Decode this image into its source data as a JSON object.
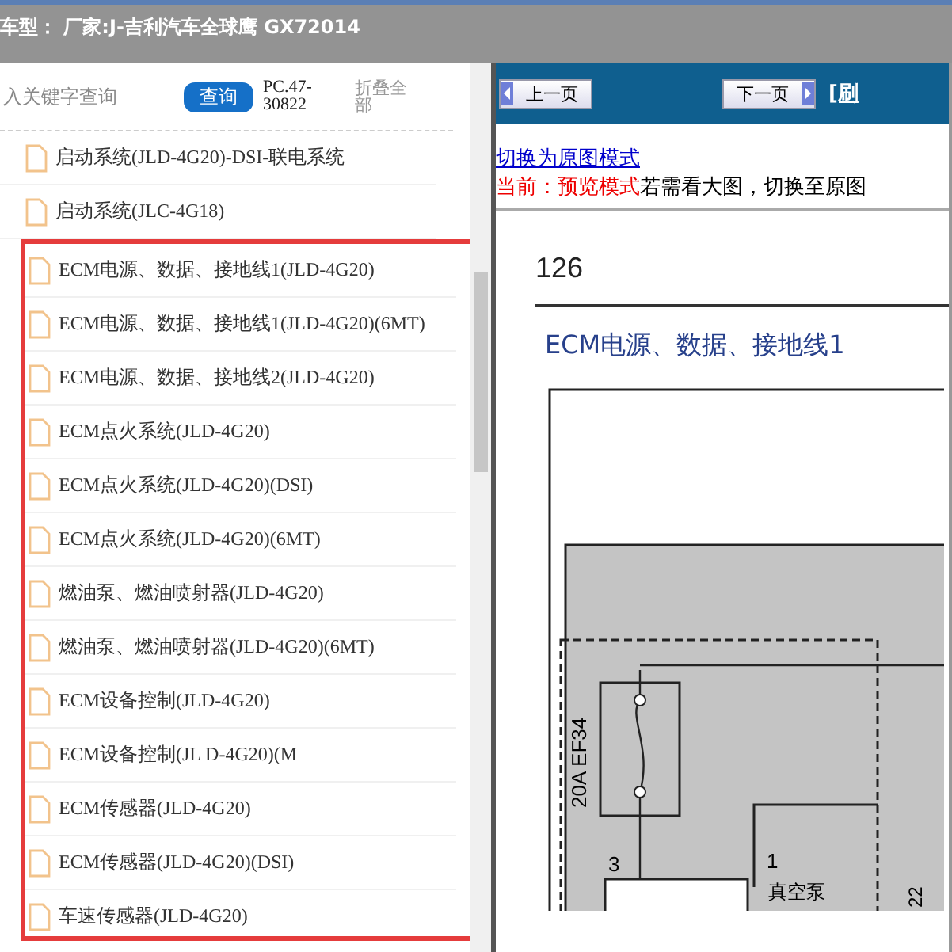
{
  "header": {
    "title": "车型： 厂家:J-吉利汽车全球鹰 GX72014"
  },
  "search": {
    "placeholder": "入关键字查询",
    "button": "查询",
    "code": "PC.47-30822",
    "collapse": "折叠全部"
  },
  "file_list": {
    "items": [
      "启动系统(JLD-4G20)-DSI-联电系统",
      "启动系统(JLC-4G18)"
    ],
    "highlighted_items": [
      "ECM电源、数据、接地线1(JLD-4G20)",
      "ECM电源、数据、接地线1(JLD-4G20)(6MT)",
      "ECM电源、数据、接地线2(JLD-4G20)",
      "ECM点火系统(JLD-4G20)",
      "ECM点火系统(JLD-4G20)(DSI)",
      "ECM点火系统(JLD-4G20)(6MT)",
      "燃油泵、燃油喷射器(JLD-4G20)",
      "燃油泵、燃油喷射器(JLD-4G20)(6MT)",
      "ECM设备控制(JLD-4G20)",
      "ECM设备控制(JL D-4G20)(M",
      "ECM传感器(JLD-4G20)",
      "ECM传感器(JLD-4G20)(DSI)",
      "车速传感器(JLD-4G20)"
    ]
  },
  "viewer": {
    "prev_button": "上一页",
    "next_button": "下一页",
    "refresh_link": "[刷",
    "mode_link": "切换为原图模式",
    "mode_status": "当前：预览模式",
    "mode_hint": "若需看大图，切换至原图",
    "page": {
      "number": "126",
      "title": "ECM电源、数据、接地线1",
      "diagram_labels": [
        "20A EF34",
        "3",
        "1",
        "22",
        "真空泵"
      ]
    }
  }
}
